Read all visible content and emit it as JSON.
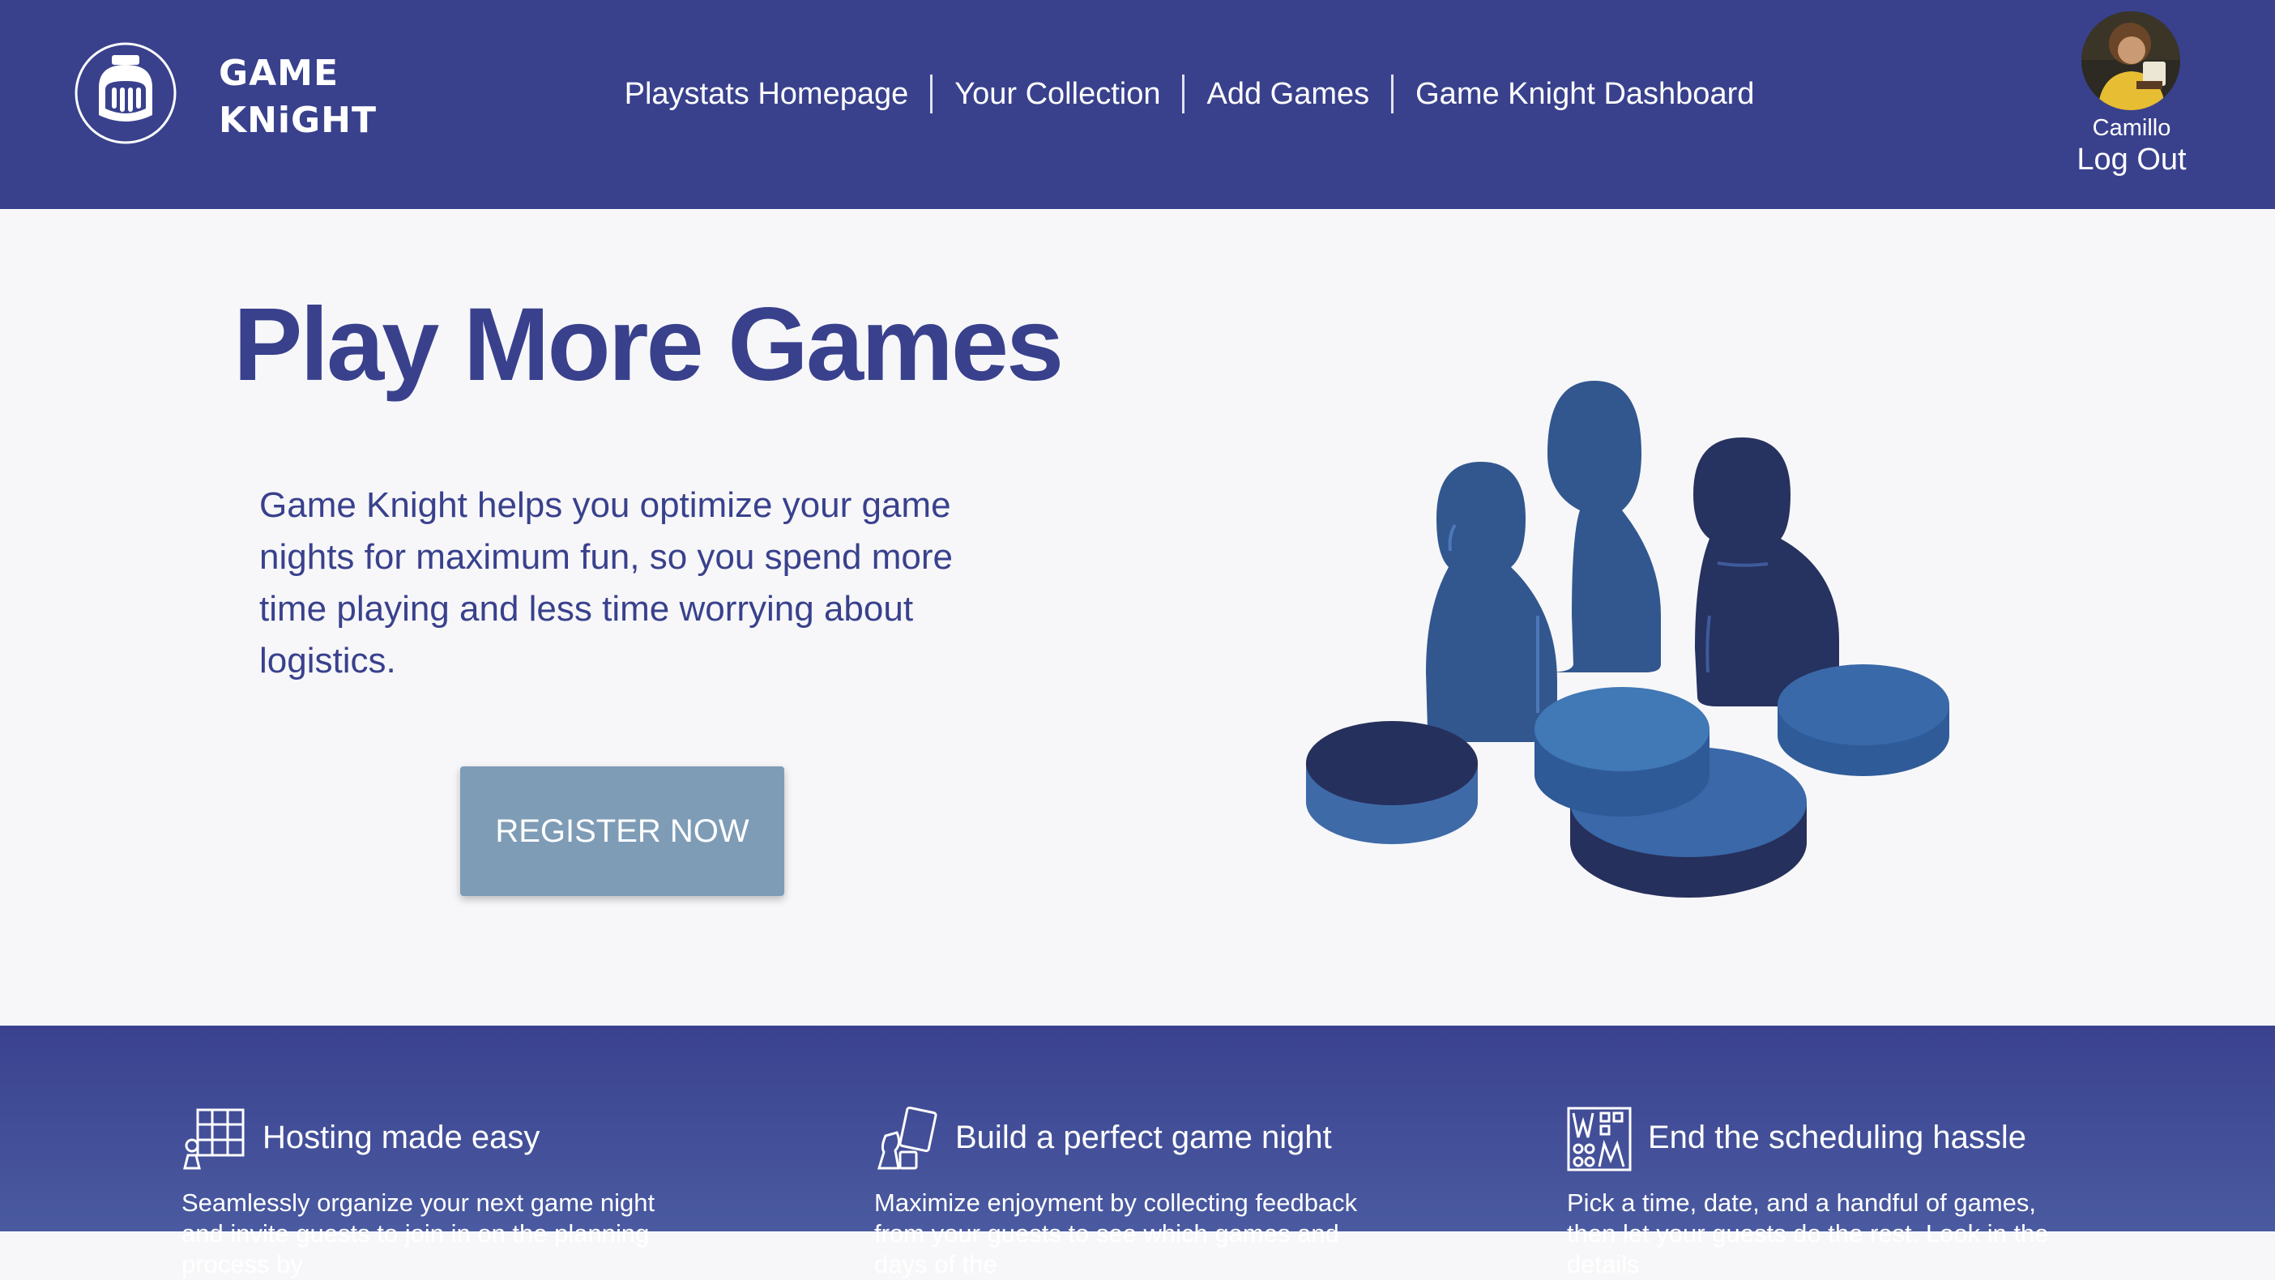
{
  "header": {
    "logo_line1": "GAME",
    "logo_line2": "KNiGHT",
    "nav": [
      {
        "label": "Playstats Homepage"
      },
      {
        "label": "Your Collection"
      },
      {
        "label": "Add Games"
      },
      {
        "label": "Game Knight Dashboard"
      }
    ],
    "user_name": "Camillo",
    "logout_label": "Log Out"
  },
  "hero": {
    "title": "Play More Games",
    "description": "Game Knight helps you optimize your game nights for maximum fun, so you spend more time playing and less time worrying about logistics.",
    "register_label": "REGISTER NOW"
  },
  "features": [
    {
      "icon": "board-grid-icon",
      "title": "Hosting made easy",
      "text": "Seamlessly organize your next game night and invite guests to join in on the planning process by"
    },
    {
      "icon": "cards-dice-icon",
      "title": "Build a perfect game night",
      "text": "Maximize enjoyment by collecting feedback from your guests to see which games and days of the"
    },
    {
      "icon": "calendar-board-icon",
      "title": "End the scheduling hassle",
      "text": "Pick a time, date, and a handful of games, then let your guests do the rest. Look in the details"
    }
  ],
  "colors": {
    "header_bg": "#39418d",
    "accent_text": "#39418d",
    "button_bg": "#7f9cb6",
    "page_bg": "#f7f7f9"
  }
}
